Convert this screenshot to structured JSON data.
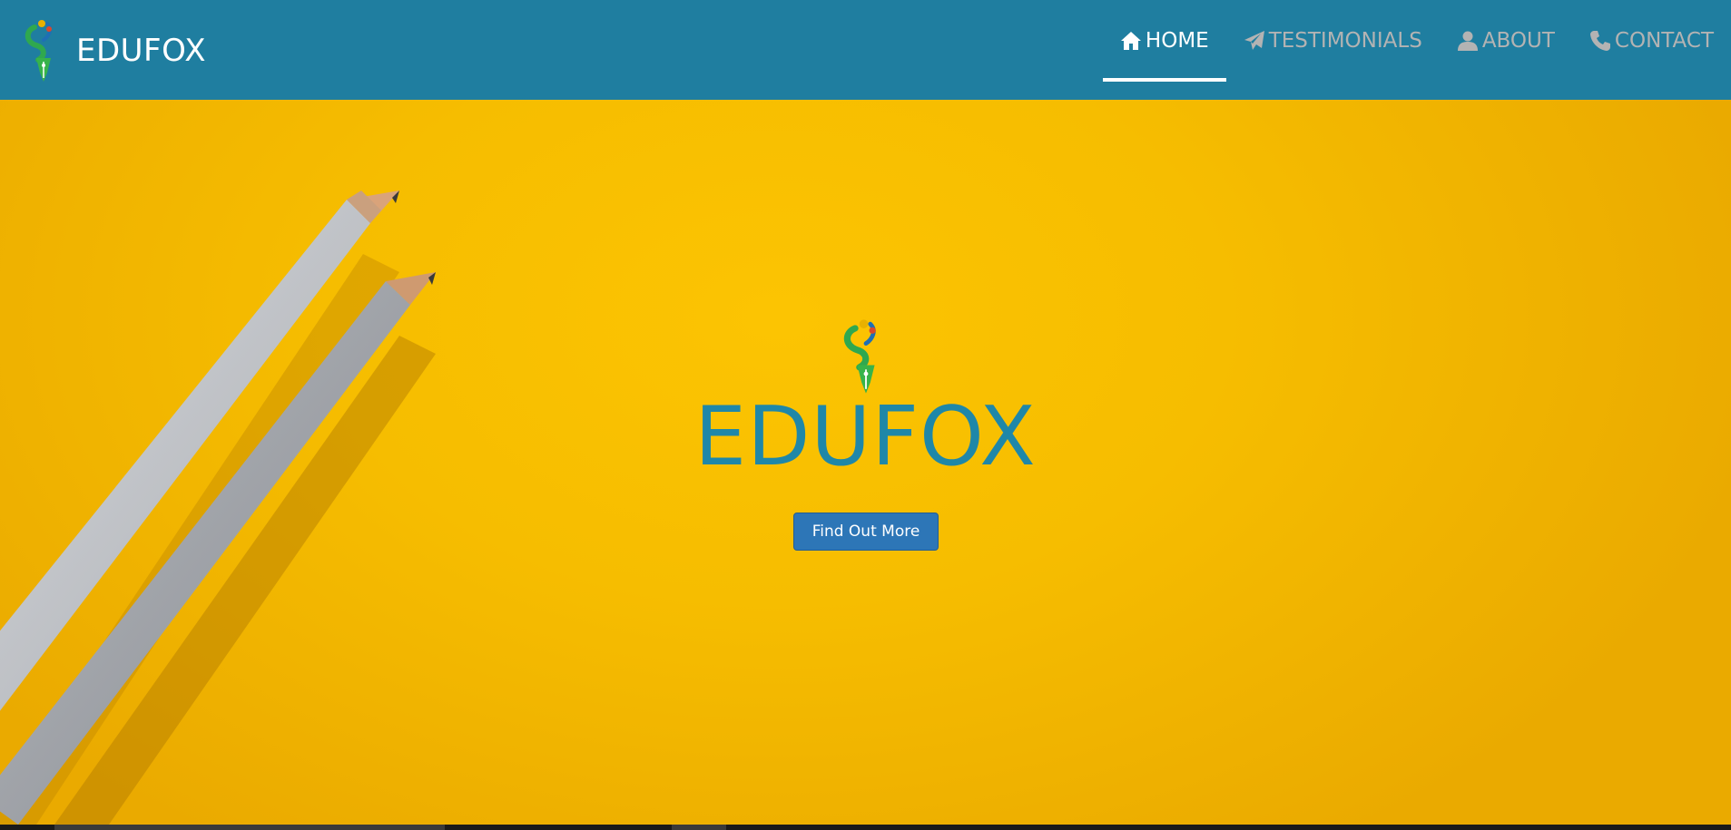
{
  "brand": {
    "name": "EDUFOX",
    "logo_icon": "edufox-pen-logo-icon"
  },
  "nav": {
    "items": [
      {
        "label": "HOME",
        "icon": "home-icon",
        "active": true
      },
      {
        "label": "TESTIMONIALS",
        "icon": "paper-plane-icon",
        "active": false
      },
      {
        "label": "ABOUT",
        "icon": "user-icon",
        "active": false
      },
      {
        "label": "CONTACT",
        "icon": "phone-icon",
        "active": false
      }
    ]
  },
  "hero": {
    "title": "EDUFOX",
    "button_label": "Find Out More",
    "background": "yellow-paper-with-pencils"
  },
  "colors": {
    "navbar": "#1f7ea0",
    "hero_background": "#f6bd00",
    "title": "#1f87a8",
    "button": "#2d76b7",
    "nav_active": "#ffffff",
    "nav_inactive": "#b3b3b3"
  }
}
